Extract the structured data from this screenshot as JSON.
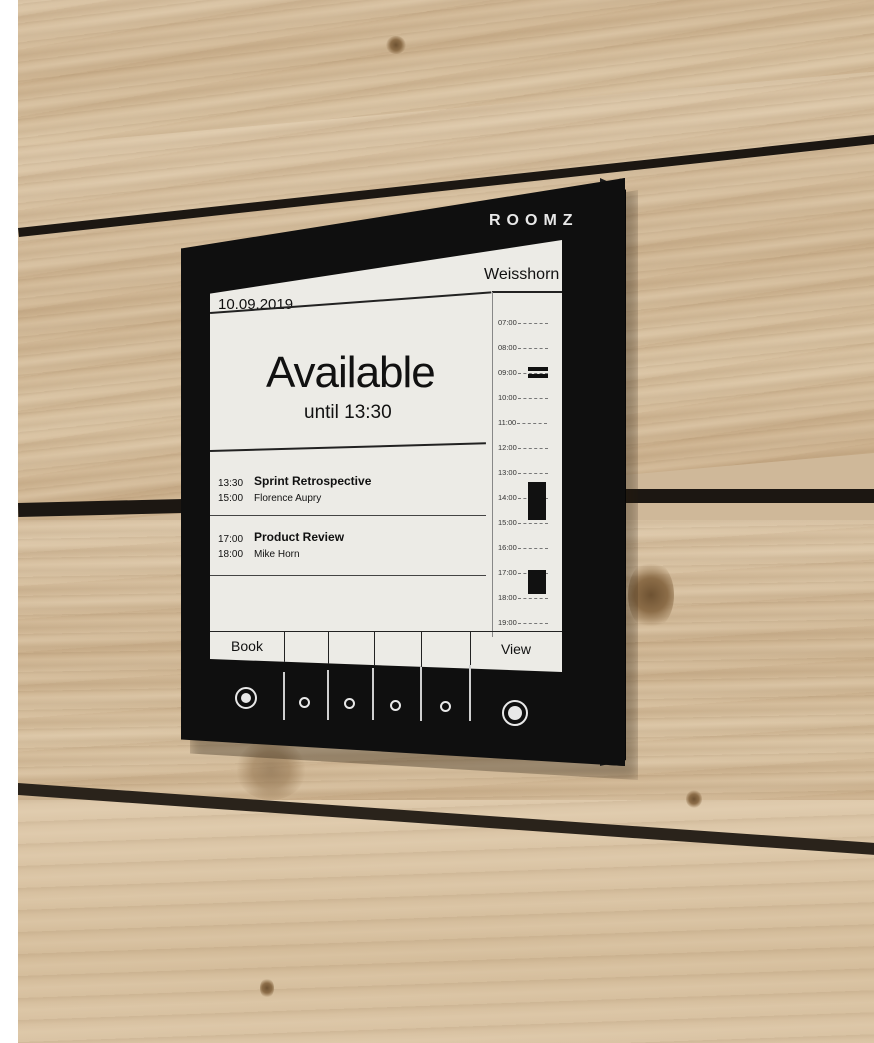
{
  "device": {
    "brand": "ROOMZ",
    "room_name": "Weisshorn",
    "date": "10.09.2019",
    "status": "Available",
    "status_detail": "until 13:30",
    "events": [
      {
        "start": "13:30",
        "end": "15:00",
        "title": "Sprint Retrospective",
        "organizer": "Florence Aupry"
      },
      {
        "start": "17:00",
        "end": "18:00",
        "title": "Product Review",
        "organizer": "Mike Horn"
      }
    ],
    "timeline": {
      "hours": [
        "07:00",
        "08:00",
        "09:00",
        "10:00",
        "11:00",
        "12:00",
        "13:00",
        "14:00",
        "15:00",
        "16:00",
        "17:00",
        "18:00",
        "19:00"
      ]
    },
    "softkeys": [
      "Book",
      "",
      "",
      "",
      "",
      "View"
    ]
  },
  "colors": {
    "bezel": "#0f0f0f",
    "screen": "#ecebe6",
    "wood": "#cfb899"
  }
}
